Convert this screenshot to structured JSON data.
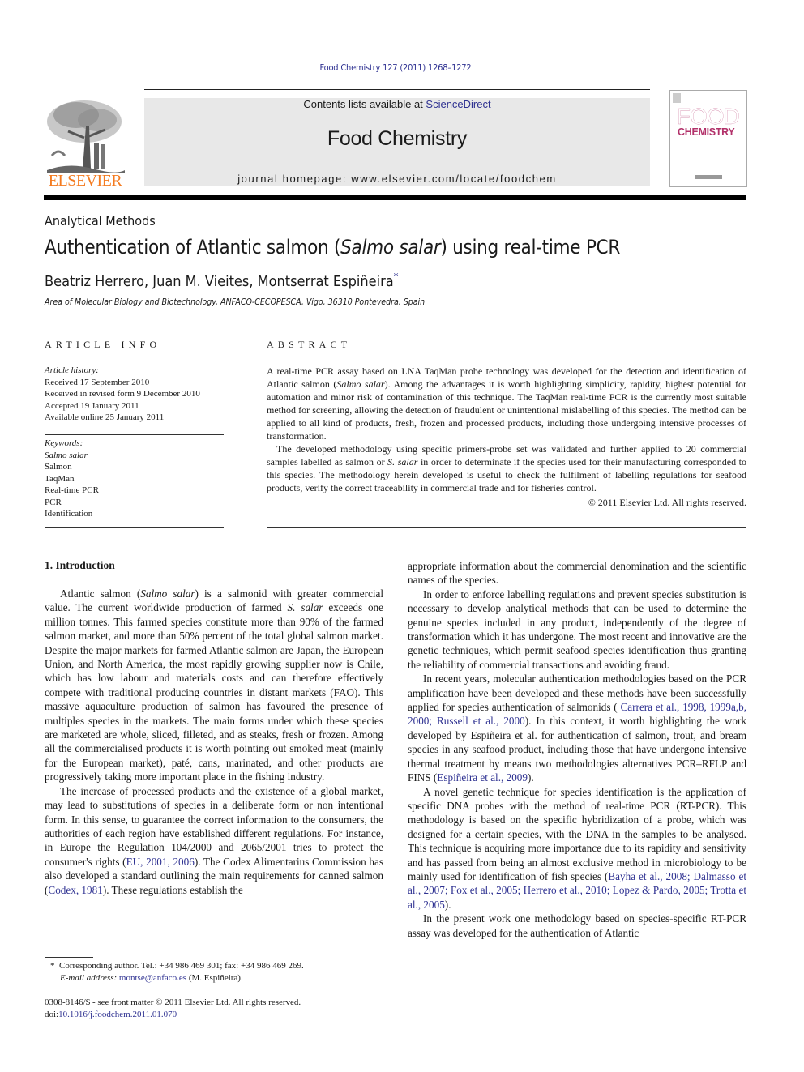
{
  "header": {
    "journal_ref": "Food Chemistry 127 (2011) 1268–1272",
    "contents_prefix": "Contents lists available at ",
    "contents_link": "ScienceDirect",
    "journal_name": "Food Chemistry",
    "homepage": "journal homepage: www.elsevier.com/locate/foodchem",
    "publisher_logo_text": "ELSEVIER",
    "cover": {
      "word1": "FOOD",
      "word2": "CHEMISTRY"
    }
  },
  "colors": {
    "link": "#2e3191",
    "elsevier_orange": "#f47b20",
    "cover_magenta": "#b2316a",
    "masthead_bg": "#e8e8e8"
  },
  "article": {
    "section_type": "Analytical Methods",
    "title_pre": "Authentication of Atlantic salmon (",
    "title_italic": "Salmo salar",
    "title_post": ") using real-time PCR",
    "authors": "Beatriz Herrero, Juan M. Vieites, Montserrat Espiñeira",
    "author_mark": "*",
    "affiliation": "Area of Molecular Biology and Biotechnology, ANFACO-CECOPESCA, Vigo, 36310 Pontevedra, Spain"
  },
  "article_info": {
    "heading": "ARTICLE INFO",
    "history_label": "Article history:",
    "history": [
      "Received 17 September 2010",
      "Received in revised form 9 December 2010",
      "Accepted 19 January 2011",
      "Available online 25 January 2011"
    ],
    "keywords_label": "Keywords:",
    "keywords": [
      "Salmo salar",
      "Salmon",
      "TaqMan",
      "Real-time PCR",
      "PCR",
      "Identification"
    ]
  },
  "abstract": {
    "heading": "ABSTRACT",
    "p1_a": "A real-time PCR assay based on LNA TaqMan probe technology was developed for the detection and identification of Atlantic salmon (",
    "p1_i": "Salmo salar",
    "p1_b": "). Among the advantages it is worth highlighting simplicity, rapidity, highest potential for automation and minor risk of contamination of this technique. The TaqMan real-time PCR is the currently most suitable method for screening, allowing the detection of fraudulent or unintentional mislabelling of this species. The method can be applied to all kind of products, fresh, frozen and processed products, including those undergoing intensive processes of transformation.",
    "p2_a": "The developed methodology using specific primers-probe set was validated and further applied to 20 commercial samples labelled as salmon or ",
    "p2_i": "S. salar",
    "p2_b": " in order to determinate if the species used for their manufacturing corresponded to this species. The methodology herein developed is useful to check the fulfilment of labelling regulations for seafood products, verify the correct traceability in commercial trade and for fisheries control.",
    "copyright": "© 2011 Elsevier Ltd. All rights reserved."
  },
  "body": {
    "intro_heading": "1. Introduction",
    "left": {
      "p1_a": "Atlantic salmon (",
      "p1_i1": "Salmo salar",
      "p1_b": ") is a salmonid with greater commercial value. The current worldwide production of farmed ",
      "p1_i2": "S. salar",
      "p1_c": " exceeds one million tonnes. This farmed species constitute more than 90% of the farmed salmon market, and more than 50% percent of the total global salmon market. Despite the major markets for farmed Atlantic salmon are Japan, the European Union, and North America, the most rapidly growing supplier now is Chile, which has low labour and materials costs and can therefore effectively compete with traditional producing countries in distant markets (FAO). This massive aquaculture production of salmon has favoured the presence of multiples species in the markets. The main forms under which these species are marketed are whole, sliced, filleted, and as steaks, fresh or frozen. Among all the commercialised products it is worth pointing out smoked meat (mainly for the European market), paté, cans, marinated, and other products are progressively taking more important place in the fishing industry.",
      "p2_a": "The increase of processed products and the existence of a global market, may lead to substitutions of species in a deliberate form or non intentional form. In this sense, to guarantee the correct information to the consumers, the authorities of each region have established different regulations. For instance, in Europe the Regulation 104/2000 and 2065/2001 tries to protect the consumer's rights (",
      "p2_link1": "EU, 2001, 2006",
      "p2_b": "). The Codex Alimentarius Commission has also developed a standard outlining the main requirements for canned salmon (",
      "p2_link2": "Codex, 1981",
      "p2_c": "). These regulations establish the"
    },
    "right": {
      "p0": "appropriate information about the commercial denomination and the scientific names of the species.",
      "p1": "In order to enforce labelling regulations and prevent species substitution is necessary to develop analytical methods that can be used to determine the genuine species included in any product, independently of the degree of transformation which it has undergone. The most recent and innovative are the genetic techniques, which permit seafood species identification thus granting the reliability of commercial transactions and avoiding fraud.",
      "p2_a": "In recent years, molecular authentication methodologies based on the PCR amplification have been developed and these methods have been successfully applied for species authentication of salmonids ( ",
      "p2_link1": "Carrera et al., 1998, 1999a,b, 2000; Russell et al., 2000",
      "p2_b": "). In this context, it worth highlighting the work developed by Espiñeira et al. for authentication of salmon, trout, and bream species in any seafood product, including those that have undergone intensive thermal treatment by means two methodologies alternatives PCR–RFLP and FINS (",
      "p2_link2": "Espiñeira et al., 2009",
      "p2_c": ").",
      "p3_a": "A novel genetic technique for species identification is the application of specific DNA probes with the method of real-time PCR (RT-PCR). This methodology is based on the specific hybridization of a probe, which was designed for a certain species, with the DNA in the samples to be analysed. This technique is acquiring more importance due to its rapidity and sensitivity and has passed from being an almost exclusive method in microbiology to be mainly used for identification of fish species (",
      "p3_link": "Bayha et al., 2008; Dalmasso et al., 2007; Fox et al., 2005; Herrero et al., 2010; Lopez & Pardo, 2005; Trotta et al., 2005",
      "p3_b": ").",
      "p4": "In the present work one methodology based on species-specific RT-PCR assay was developed for the authentication of Atlantic"
    }
  },
  "footer": {
    "fn_star": "*",
    "fn_contact": "Corresponding author. Tel.: +34 986 469 301; fax: +34 986 469 269.",
    "fn_email_label": "E-mail address:",
    "fn_email": "montse@anfaco.es",
    "fn_email_after": " (M. Espiñeira).",
    "front_matter": "0308-8146/$ - see front matter © 2011 Elsevier Ltd. All rights reserved.",
    "doi_label": "doi:",
    "doi": "10.1016/j.foodchem.2011.01.070"
  }
}
